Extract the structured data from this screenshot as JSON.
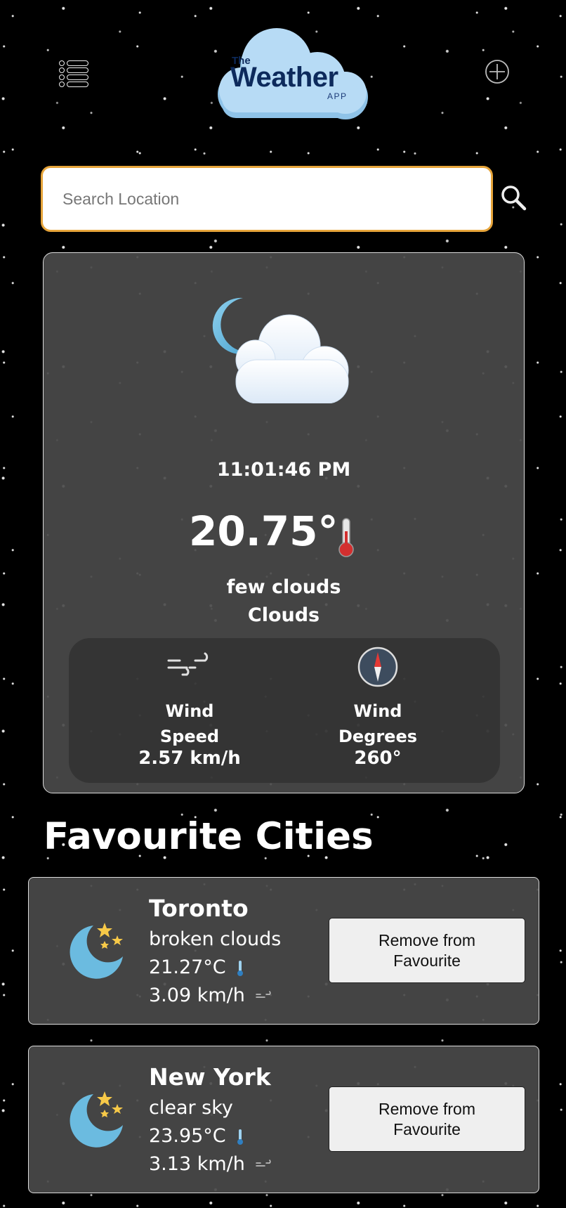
{
  "header": {
    "logo": {
      "line1": "The",
      "line2": "Weather",
      "line3": "APP"
    }
  },
  "search": {
    "placeholder": "Search Location"
  },
  "current": {
    "time": "11:01:46 PM",
    "temperature": "20.75°",
    "description": "few clouds",
    "main": "Clouds",
    "wind_speed_label_1": "Wind",
    "wind_speed_label_2": "Speed",
    "wind_speed": "2.57 km/h",
    "wind_deg_label_1": "Wind",
    "wind_deg_label_2": "Degrees",
    "wind_degrees": "260°"
  },
  "favourites": {
    "title": "Favourite Cities",
    "items": [
      {
        "city": "Toronto",
        "description": "broken clouds",
        "temperature": "21.27°C",
        "wind": "3.09 km/h",
        "button": "Remove from Favourite"
      },
      {
        "city": "New York",
        "description": "clear sky",
        "temperature": "23.95°C",
        "wind": "3.13 km/h",
        "button": "Remove from Favourite"
      }
    ]
  },
  "colors": {
    "search_border": "#e6a43a",
    "logo_text": "#0d2a5c",
    "cloud": "#a9d4f2",
    "moon": "#6bb8dc",
    "card_bg": "#4a4a4a"
  }
}
